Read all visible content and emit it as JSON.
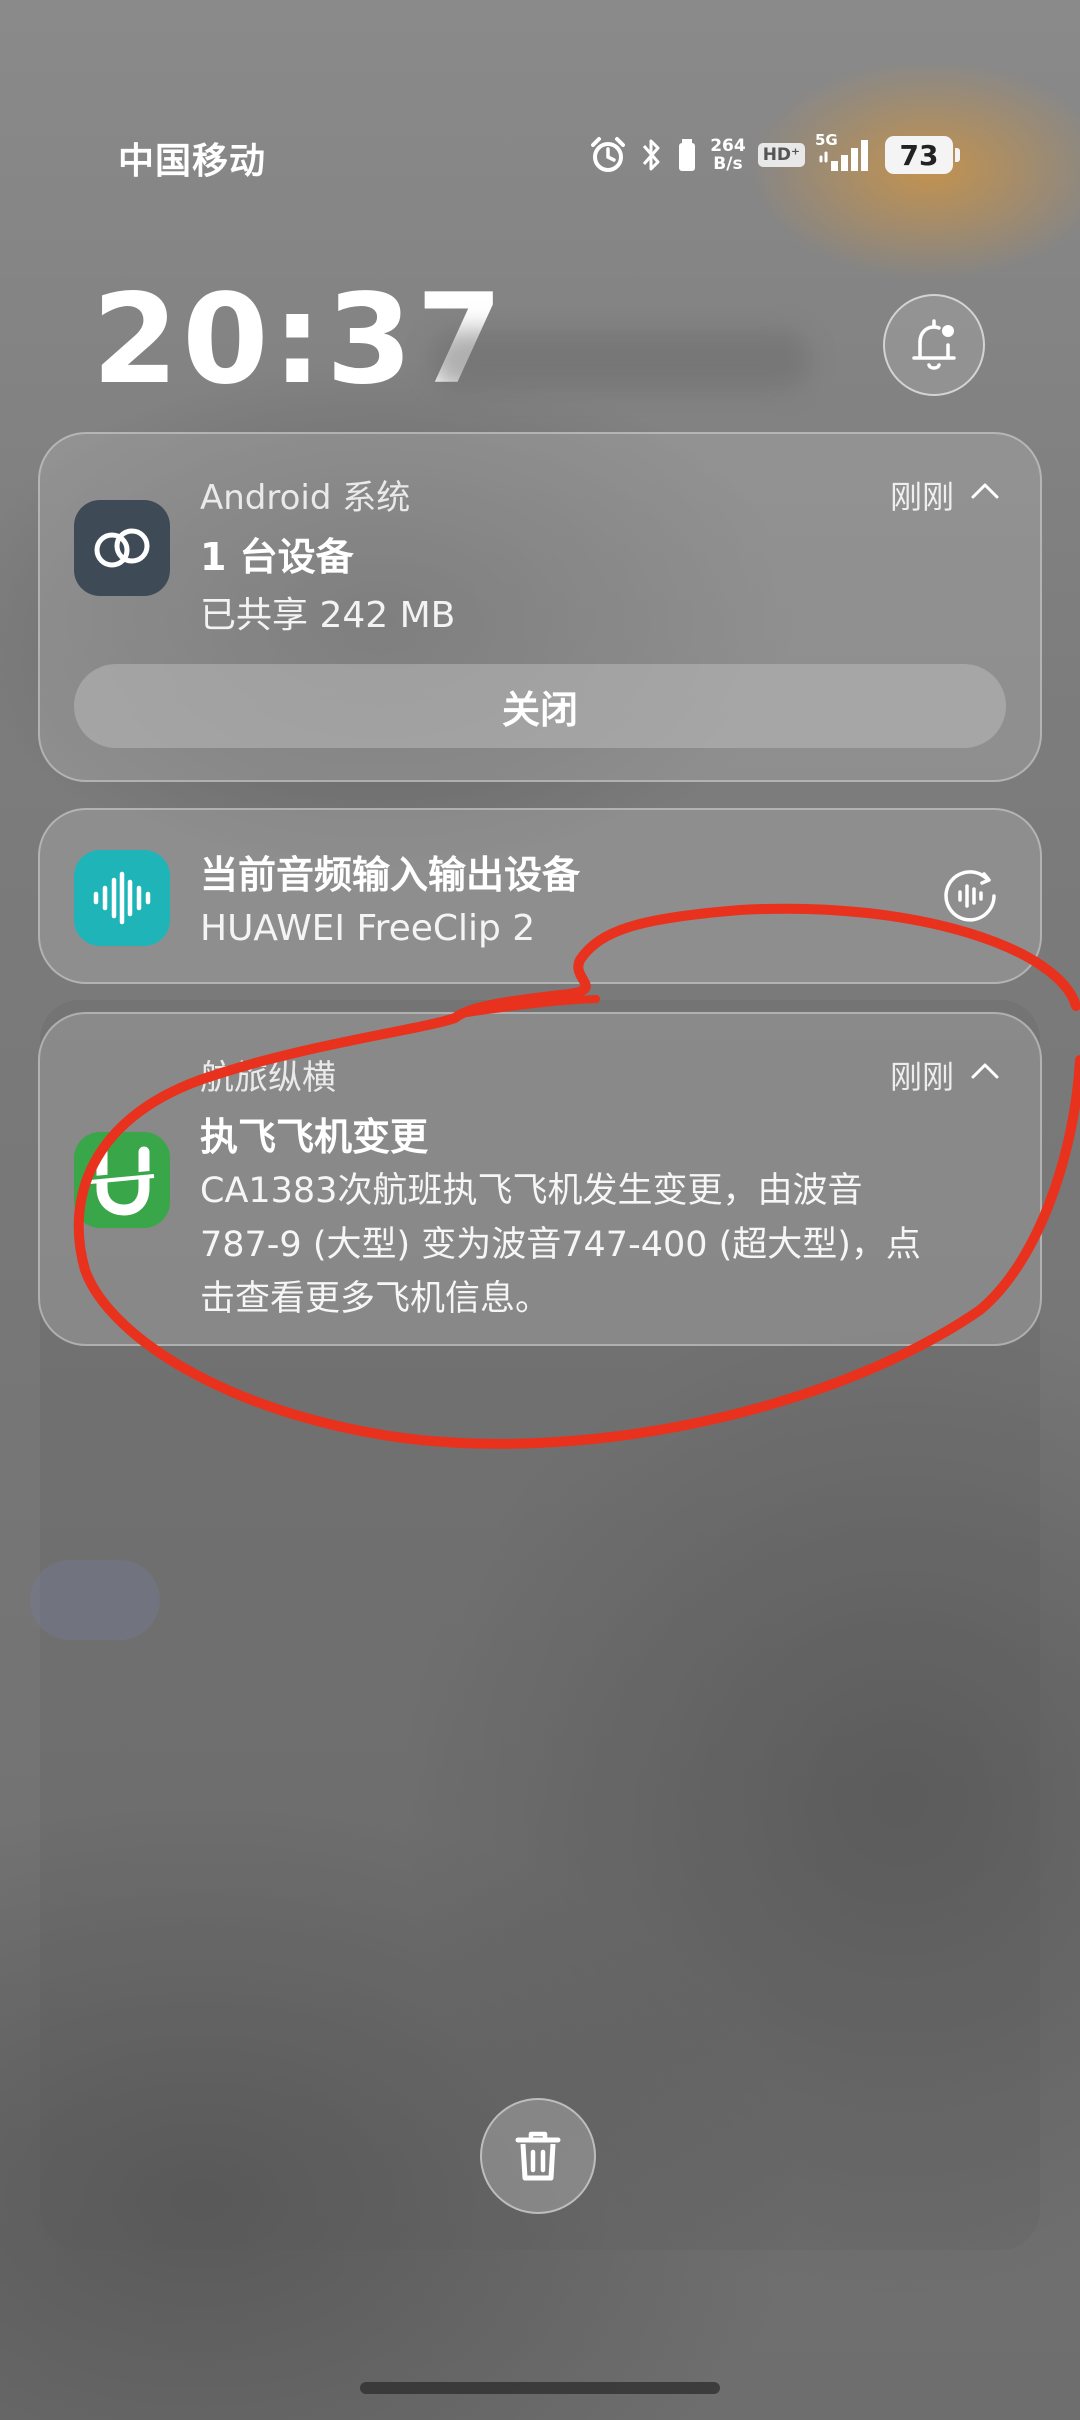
{
  "status_bar": {
    "carrier": "中国移动",
    "net_speed_value": "264",
    "net_speed_unit": "B/s",
    "hd_label": "HD⁺",
    "signal_label": "5G",
    "battery_level": "73",
    "icons": [
      "alarm-icon",
      "bluetooth-icon",
      "earbuds-battery-icon",
      "signal-icon",
      "battery-icon"
    ]
  },
  "lock": {
    "time": "20:37"
  },
  "notifications": [
    {
      "app_name": "Android 系统",
      "time": "刚刚",
      "title": "1 台设备",
      "text": "已共享 242 MB",
      "action_label": "关闭",
      "icon": "link-icon",
      "icon_color": "#3e4a56"
    },
    {
      "title": "当前音频输入输出设备",
      "text": "HUAWEI FreeClip 2",
      "icon": "audio-wave-icon",
      "icon_color": "#1fb5b8"
    },
    {
      "app_name": "航旅纵横",
      "time": "刚刚",
      "title": "执飞飞机变更",
      "lines": [
        "CA1383次航班执飞飞机发生变更，由波音",
        "787-9 (大型) 变为波音747-400 (超大型)，点",
        "击查看更多飞机信息。"
      ],
      "icon": "umetrip-icon",
      "icon_color": "#3aa64a"
    }
  ],
  "annotation_color": "#e8321e"
}
